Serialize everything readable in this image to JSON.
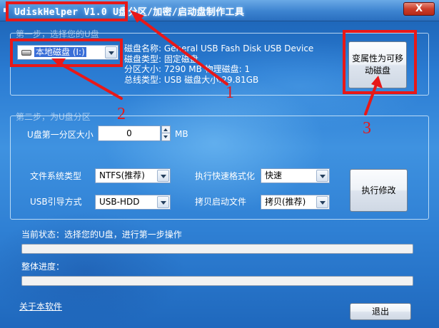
{
  "window": {
    "title": "UdiskHelper V1.0  U盘分区/加密/启动盘制作工具",
    "close_label": "X"
  },
  "step1": {
    "legend": "第一步，选择您的U盘",
    "drive_select": "本地磁盘 (I:)",
    "info": [
      "磁盘名称: General USB Fash Disk USB Device",
      "磁盘类型: 固定磁盘",
      "分区大小: 7290 MB   物理磁盘: 1",
      "总线类型: USB     磁盘大小:29.81GB"
    ],
    "convert_button": "变属性为可移动磁盘"
  },
  "step2": {
    "legend": "第二步，为U盘分区",
    "partition_label": "U盘第一分区大小",
    "partition_value": "0",
    "partition_unit": "MB",
    "fs_label": "文件系统类型",
    "fs_value": "NTFS(推荐)",
    "quickformat_label": "执行快速格式化",
    "quickformat_value": "快速",
    "boot_label": "USB引导方式",
    "boot_value": "USB-HDD",
    "copyboot_label": "拷贝启动文件",
    "copyboot_value": "拷贝(推荐)",
    "execute_button": "执行修改"
  },
  "status": {
    "current_label": "当前状态：选择您的U盘，进行第一步操作",
    "current_progress": 0,
    "overall_label": "整体进度：",
    "overall_progress": 0
  },
  "footer": {
    "about_link": "关于本软件",
    "exit_button": "退出"
  },
  "annotations": {
    "one": "1",
    "two": "2",
    "three": "3",
    "color": "#e81818"
  }
}
